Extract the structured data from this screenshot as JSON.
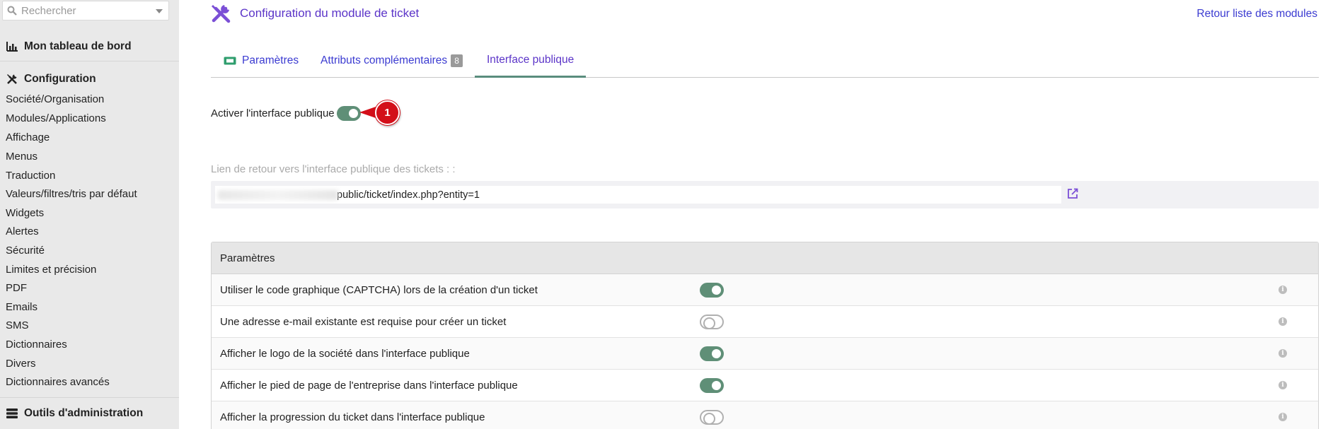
{
  "sidebar": {
    "search_placeholder": "Rechercher",
    "dashboard_label": "Mon tableau de bord",
    "configuration_label": "Configuration",
    "items": [
      {
        "label": "Société/Organisation"
      },
      {
        "label": "Modules/Applications"
      },
      {
        "label": "Affichage"
      },
      {
        "label": "Menus"
      },
      {
        "label": "Traduction"
      },
      {
        "label": "Valeurs/filtres/tris par défaut"
      },
      {
        "label": "Widgets"
      },
      {
        "label": "Alertes"
      },
      {
        "label": "Sécurité"
      },
      {
        "label": "Limites et précision"
      },
      {
        "label": "PDF"
      },
      {
        "label": "Emails"
      },
      {
        "label": "SMS"
      },
      {
        "label": "Dictionnaires"
      },
      {
        "label": "Divers"
      },
      {
        "label": "Dictionnaires avancés"
      }
    ],
    "admin_tools_label": "Outils d'administration"
  },
  "header": {
    "title": "Configuration du module de ticket",
    "back_link": "Retour liste des modules"
  },
  "tabs": [
    {
      "label": "Paramètres",
      "active": false
    },
    {
      "label": "Attributs complémentaires",
      "badge": "8",
      "active": false
    },
    {
      "label": "Interface publique",
      "active": true
    }
  ],
  "public_interface": {
    "enable_label": "Activer l'interface publique",
    "enabled": true,
    "callout_number": "1",
    "url_label": "Lien de retour vers l'interface publique des tickets : :",
    "url_value": "public/ticket/index.php?entity=1"
  },
  "params_table": {
    "header": "Paramètres",
    "rows": [
      {
        "label": "Utiliser le code graphique (CAPTCHA) lors de la création d'un ticket",
        "enabled": true
      },
      {
        "label": "Une adresse e-mail existante est requise pour créer un ticket",
        "enabled": false
      },
      {
        "label": "Afficher le logo de la société dans l'interface publique",
        "enabled": true
      },
      {
        "label": "Afficher le pied de page de l'entreprise dans l'interface publique",
        "enabled": true
      },
      {
        "label": "Afficher la progression du ticket dans l'interface publique",
        "enabled": false
      }
    ]
  },
  "colors": {
    "accent_purple": "#5b34c8",
    "link_blue": "#3b3bd1",
    "toggle_on": "#5f8f77",
    "callout_red": "#d30f19",
    "sidebar_bg": "#e9e9e9"
  },
  "icons": {
    "search": "search-icon",
    "dashboard": "bar-chart-icon",
    "configuration": "tools-icon",
    "admin_tools": "server-icon",
    "module": "tools-icon",
    "params_tab": "ticket-icon",
    "external": "external-link-icon",
    "info": "info-icon"
  }
}
